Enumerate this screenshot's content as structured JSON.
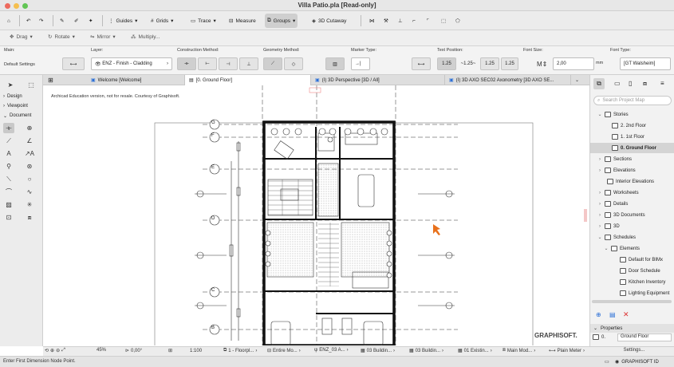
{
  "window": {
    "title": "Villa Patio.pla [Read-only]"
  },
  "toolbar": {
    "guides": "Guides",
    "grids": "Grids",
    "trace": "Trace",
    "measure": "Measure",
    "groups": "Groups",
    "cutaway": "3D Cutaway"
  },
  "edit_toolbar": {
    "drag": "Drag",
    "rotate": "Rotate",
    "mirror": "Mirror",
    "multiply": "Multiply..."
  },
  "infobox": {
    "main_label": "Main:",
    "main_value": "Default Settings",
    "layer_label": "Layer:",
    "layer_value": "ENZ - Finish - Cladding",
    "construction_label": "Construction Method:",
    "geometry_label": "Geometry Method:",
    "marker_label": "Marker Type:",
    "text_position_label": "Text Position:",
    "text_pos_a": "1.25",
    "text_pos_b": "~1.25~",
    "text_pos_c": "1.25",
    "text_pos_d": "1.25",
    "font_size_label": "Font Size:",
    "font_size_value": "2,00",
    "font_size_unit": "mm",
    "font_type_label": "Font Type:",
    "font_type_value": "[GT Walsheim]"
  },
  "toolbox": {
    "design": "Design",
    "viewpoint": "Viewpoint",
    "document": "Document"
  },
  "tabs": [
    {
      "label": "Welcome [Welcome]"
    },
    {
      "label": "[0. Ground Floor]"
    },
    {
      "label": "(I) 3D Perspective [3D / All]"
    },
    {
      "label": "(I) 3D AXO SEC02 Axonometry [3D AXO SE..."
    }
  ],
  "canvas": {
    "watermark": "Archicad Education version, not for resale. Courtesy of Graphisoft.",
    "grid_labels": [
      "G",
      "F",
      "E",
      "D",
      "C",
      "B"
    ],
    "brand": "GRAPHISOFT."
  },
  "navigator": {
    "search_placeholder": "Search Project Map",
    "items": [
      {
        "label": "Stories"
      },
      {
        "label": "2. 2nd Floor"
      },
      {
        "label": "1. 1st Floor"
      },
      {
        "label": "0. Ground Floor"
      },
      {
        "label": "Sections"
      },
      {
        "label": "Elevations"
      },
      {
        "label": "Interior Elevations"
      },
      {
        "label": "Worksheets"
      },
      {
        "label": "Details"
      },
      {
        "label": "3D Documents"
      },
      {
        "label": "3D"
      },
      {
        "label": "Schedules"
      },
      {
        "label": "Elements"
      },
      {
        "label": "Default for BIMx"
      },
      {
        "label": "Door Schedule"
      },
      {
        "label": "Kitchen Inventory"
      },
      {
        "label": "Lighting Equipment"
      }
    ],
    "properties_title": "Properties",
    "prop_id": "0.",
    "prop_name": "Ground Floor",
    "settings": "Settings..."
  },
  "statusbar": {
    "zoom": "45%",
    "angle": "0,00°",
    "scale": "1:100",
    "layer_combo": "1 - Floorpl...",
    "model_view": "Entire Mo...",
    "pen_set": "ENZ_03 A...",
    "override1": "03 Buildin...",
    "override2": "03 Buildin...",
    "renovation": "01 Existin...",
    "main_model": "Main Mod...",
    "plain_meter": "Plain Meter"
  },
  "bottombar": {
    "prompt": "Enter First Dimension Node Point.",
    "graphisoft_id": "GRAPHISOFT ID"
  },
  "colors": {
    "accent": "#2b6fd6",
    "cursor": "#e8711c",
    "selected_tab": "#ffffff"
  }
}
